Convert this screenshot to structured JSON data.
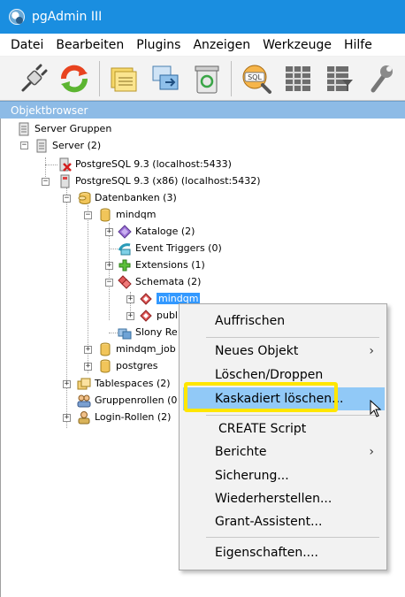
{
  "window": {
    "title": "pgAdmin III"
  },
  "menu": [
    "Datei",
    "Bearbeiten",
    "Plugins",
    "Anzeigen",
    "Werkzeuge",
    "Hilfe"
  ],
  "toolbar": {
    "buttons": [
      "plug-icon",
      "refresh-icon",
      "properties-icon",
      "create-object-icon",
      "delete-icon",
      "sql-icon",
      "view-data-icon",
      "filter-data-icon",
      "maintenance-icon"
    ]
  },
  "panel": {
    "title": "Objektbrowser"
  },
  "tree": {
    "server_groups": "Server Gruppen",
    "servers": "Server (2)",
    "pg93": "PostgreSQL 9.3 (localhost:5433)",
    "pg93x86": "PostgreSQL 9.3 (x86) (localhost:5432)",
    "databases": "Datenbanken (3)",
    "db_mindqm": "mindqm",
    "catalogs": "Kataloge  (2)",
    "event_triggers": "Event Triggers (0)",
    "extensions": "Extensions  (1)",
    "schemata": "Schemata (2)",
    "schema_mindqm": "mindqm",
    "schema_public": "publ",
    "slony": "Slony Re",
    "db_mindqm_job": "mindqm_job",
    "db_postgres": "postgres",
    "tablespaces": "Tablespaces (2)",
    "group_roles": "Gruppenrollen (0",
    "login_roles": "Login-Rollen (2)"
  },
  "context_menu": {
    "refresh": "Auffrischen",
    "new_object": "Neues Objekt",
    "delete_drop": "Löschen/Droppen",
    "delete_cascade": "Kaskadiert löschen...",
    "create_script": "CREATE Script",
    "reports": "Berichte",
    "backup": "Sicherung...",
    "restore": "Wiederherstellen...",
    "grant_wizard": "Grant-Assistent...",
    "properties": "Eigenschaften...."
  },
  "colors": {
    "titlebar": "#1a8ee0",
    "panel_header": "#8dbbe6",
    "selection": "#3399ff",
    "menu_hover": "#91c9f7",
    "highlight": "#ffe600"
  }
}
